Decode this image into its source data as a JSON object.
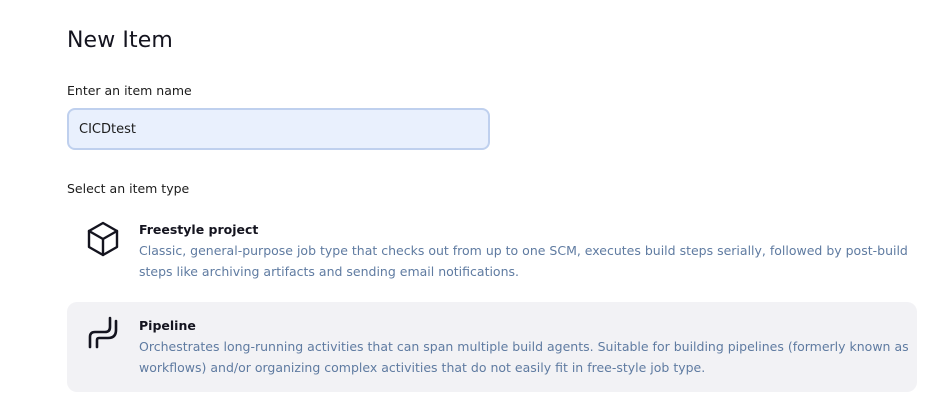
{
  "page": {
    "title": "New Item"
  },
  "name_field": {
    "label": "Enter an item name",
    "value": "CICDtest"
  },
  "item_type": {
    "label": "Select an item type",
    "options": [
      {
        "name": "Freestyle project",
        "description": "Classic, general-purpose job type that checks out from up to one SCM, executes build steps serially, followed by post-build steps like archiving artifacts and sending email notifications.",
        "icon": "freestyle-box-icon",
        "selected": false
      },
      {
        "name": "Pipeline",
        "description": "Orchestrates long-running activities that can span multiple build agents. Suitable for building pipelines (formerly known as workflows) and/or organizing complex activities that do not easily fit in free-style job type.",
        "icon": "pipeline-icon",
        "selected": true
      }
    ]
  },
  "colors": {
    "input_background": "#e9f0fd",
    "input_border": "#bfd0ee",
    "description_text": "#5f7ba1",
    "selected_background": "#f2f2f5"
  }
}
